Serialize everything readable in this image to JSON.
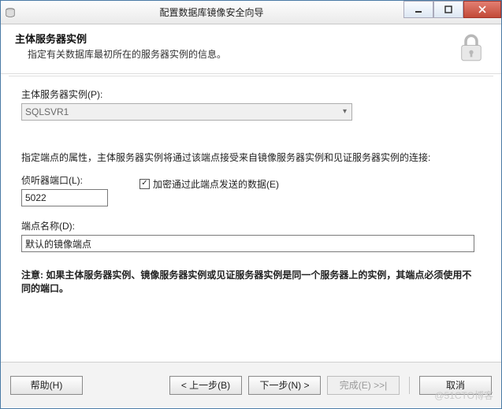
{
  "window": {
    "title": "配置数据库镜像安全向导",
    "icon": "db-icon"
  },
  "header": {
    "title": "主体服务器实例",
    "subtitle": "指定有关数据库最初所在的服务器实例的信息。"
  },
  "form": {
    "principal_label": "主体服务器实例(P):",
    "principal_value": "SQLSVR1",
    "endpoint_intro": "指定端点的属性，主体服务器实例将通过该端点接受来自镜像服务器实例和见证服务器实例的连接:",
    "listener_port_label": "侦听器端口(L):",
    "listener_port_value": "5022",
    "encrypt_checked": true,
    "encrypt_label": "加密通过此端点发送的数据(E)",
    "endpoint_name_label": "端点名称(D):",
    "endpoint_name_value": "默认的镜像端点",
    "note": "注意: 如果主体服务器实例、镜像服务器实例或见证服务器实例是同一个服务器上的实例，其端点必须使用不同的端口。"
  },
  "footer": {
    "help": "帮助(H)",
    "back": "< 上一步(B)",
    "next": "下一步(N) >",
    "finish": "完成(E) >>|",
    "cancel": "取消"
  },
  "watermark": "@51CTO博客"
}
